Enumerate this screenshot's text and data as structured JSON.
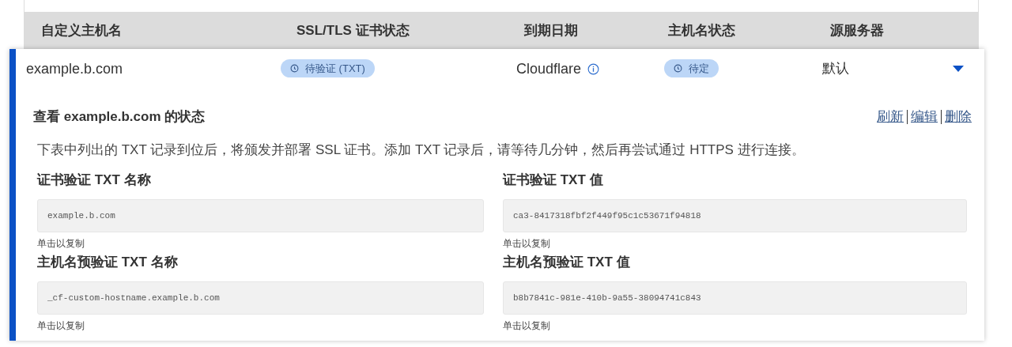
{
  "table": {
    "columns": [
      "自定义主机名",
      "SSL/TLS 证书状态",
      "到期日期",
      "主机名状态",
      "源服务器"
    ],
    "rows": [
      {
        "hostname": "example.b.com",
        "ssl_status": "待验证 (TXT)",
        "expiry": "Cloudflare",
        "hostname_status": "待定",
        "origin": "默认",
        "expanded": true,
        "details": {
          "title": "查看 example.b.com 的状态",
          "actions": [
            "刷新",
            "编辑",
            "删除"
          ],
          "description": "下表中列出的 TXT 记录到位后，将颁发并部署 SSL 证书。添加 TXT 记录后，请等待几分钟，然后再尝试通过 HTTPS 进行连接。",
          "records": [
            {
              "label": "证书验证 TXT 名称",
              "value": "example.b.com",
              "hint": "单击以复制"
            },
            {
              "label": "证书验证 TXT 值",
              "value": "ca3-8417318fbf2f449f95c1c53671f94818",
              "hint": "单击以复制"
            },
            {
              "label": "主机名预验证 TXT 名称",
              "value": "_cf-custom-hostname.example.b.com",
              "hint": "单击以复制"
            },
            {
              "label": "主机名预验证 TXT 值",
              "value": "b8b7841c-981e-410b-9a55-38094741c843",
              "hint": "单击以复制"
            }
          ]
        }
      }
    ]
  }
}
